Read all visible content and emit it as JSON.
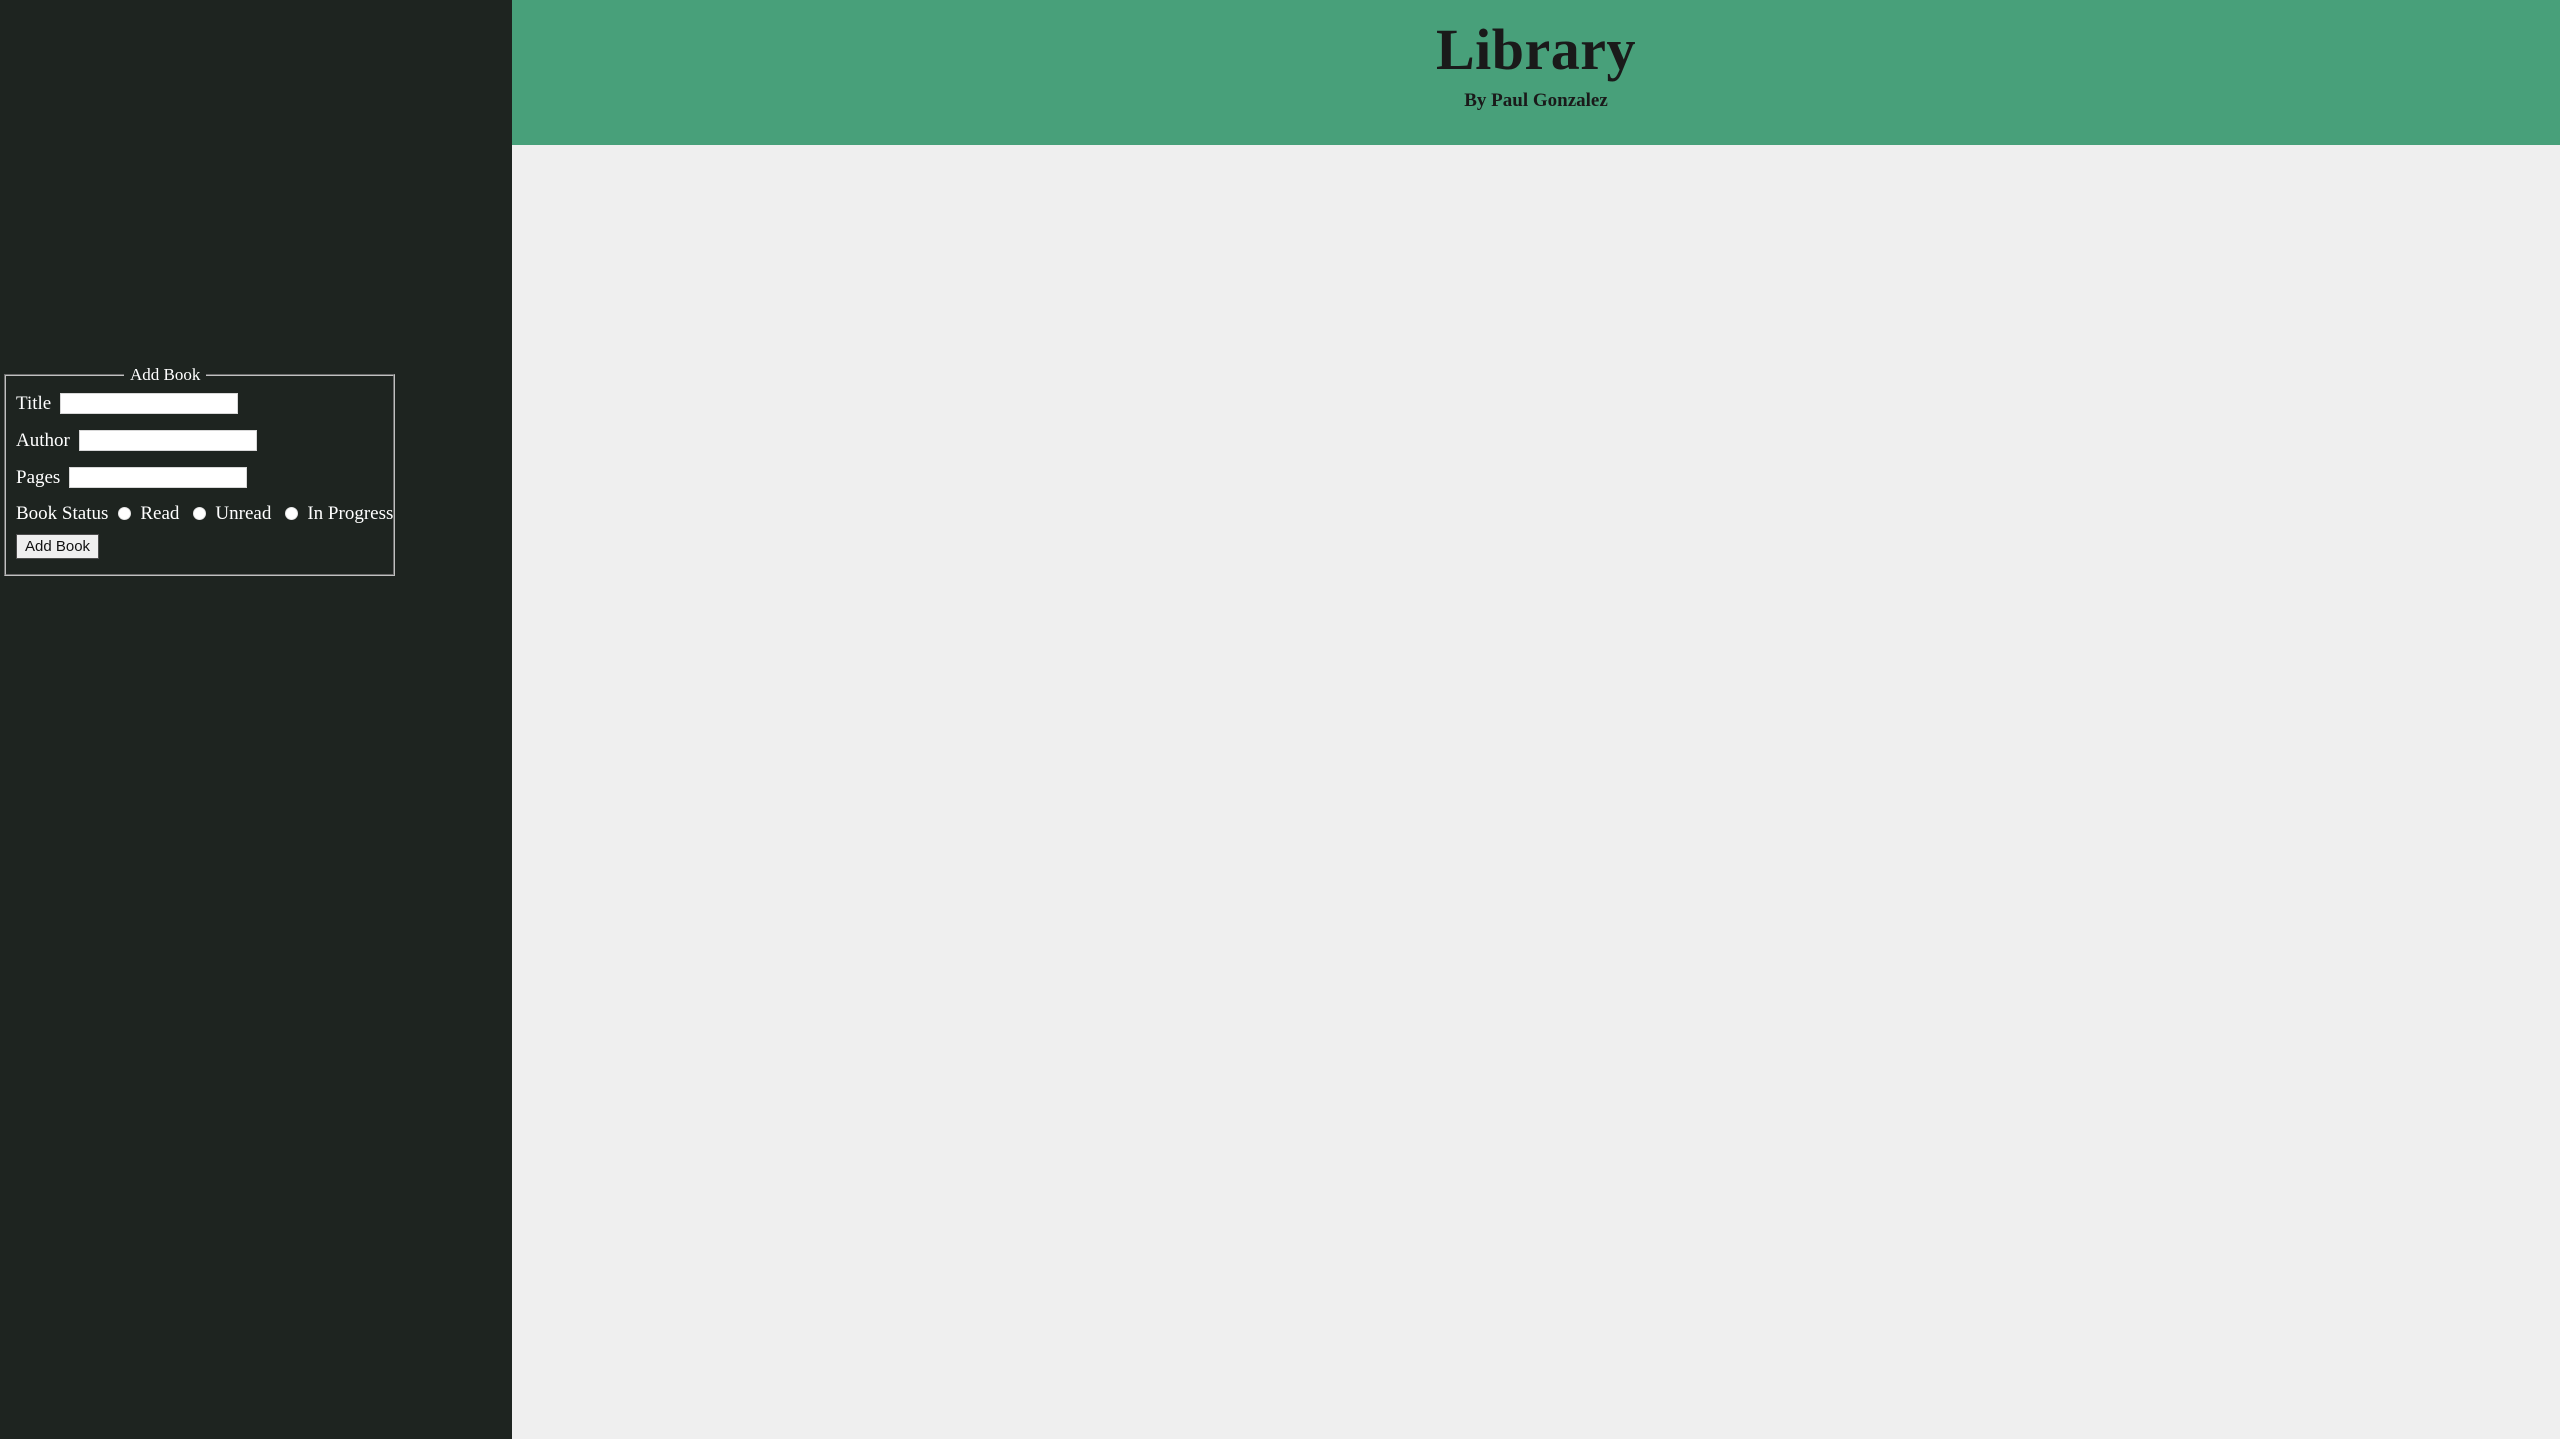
{
  "theme": {
    "sidebar_bg": "#1e2420",
    "header_bg": "#48a07a",
    "content_bg": "#efefef",
    "text_light": "#ffffff",
    "text_dark": "#1a1a1a",
    "button_bg": "#efefef"
  },
  "header": {
    "title": "Library",
    "subtitle": "By Paul Gonzalez"
  },
  "sidebar": {
    "form": {
      "legend": "Add Book",
      "fields": [
        {
          "label": "Title",
          "value": "",
          "placeholder": ""
        },
        {
          "label": "Author",
          "value": "",
          "placeholder": ""
        },
        {
          "label": "Pages",
          "value": "",
          "placeholder": ""
        }
      ],
      "status": {
        "label": "Book Status",
        "options": [
          {
            "label": "Read",
            "selected": false
          },
          {
            "label": "Unread",
            "selected": false
          },
          {
            "label": "In Progress",
            "selected": false
          }
        ]
      },
      "submit_label": "Add Book"
    }
  },
  "main": {
    "books": []
  }
}
